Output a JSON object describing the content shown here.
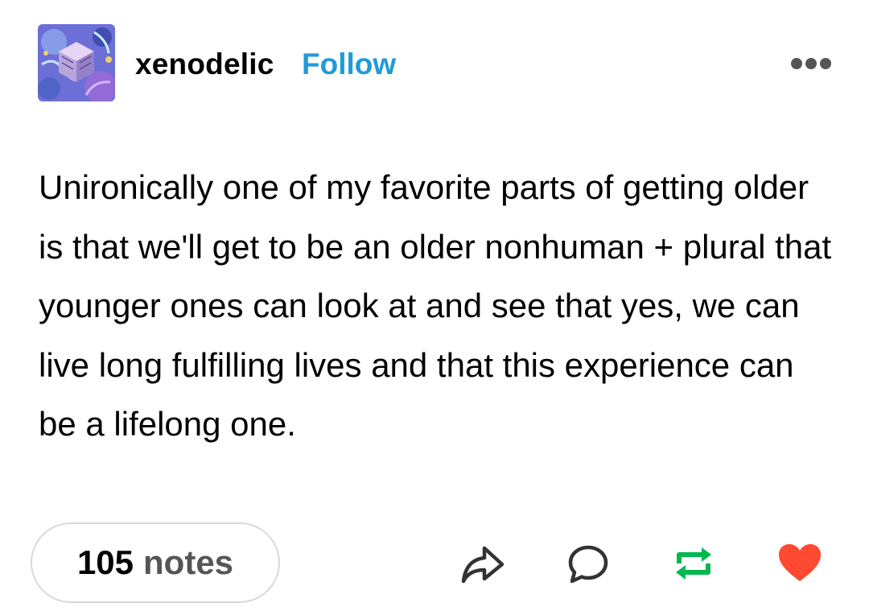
{
  "post": {
    "author": "xenodelic",
    "follow_label": "Follow",
    "body": "Unironically one of my favorite parts of getting older is that we'll get to be an older nonhuman + plural that younger ones can look at and see that yes, we can live long fulfilling lives and that this experience can be a lifelong one.",
    "notes_count": "105",
    "notes_label": "notes"
  },
  "icons": {
    "avatar": "avatar-cube-image",
    "more": "more-horizontal-icon",
    "share": "share-arrow-icon",
    "reply": "reply-bubble-icon",
    "reblog": "reblog-arrows-icon",
    "like": "heart-icon"
  },
  "colors": {
    "follow": "#1f9bd7",
    "reblog": "#00b84f",
    "like": "#ff4930"
  }
}
